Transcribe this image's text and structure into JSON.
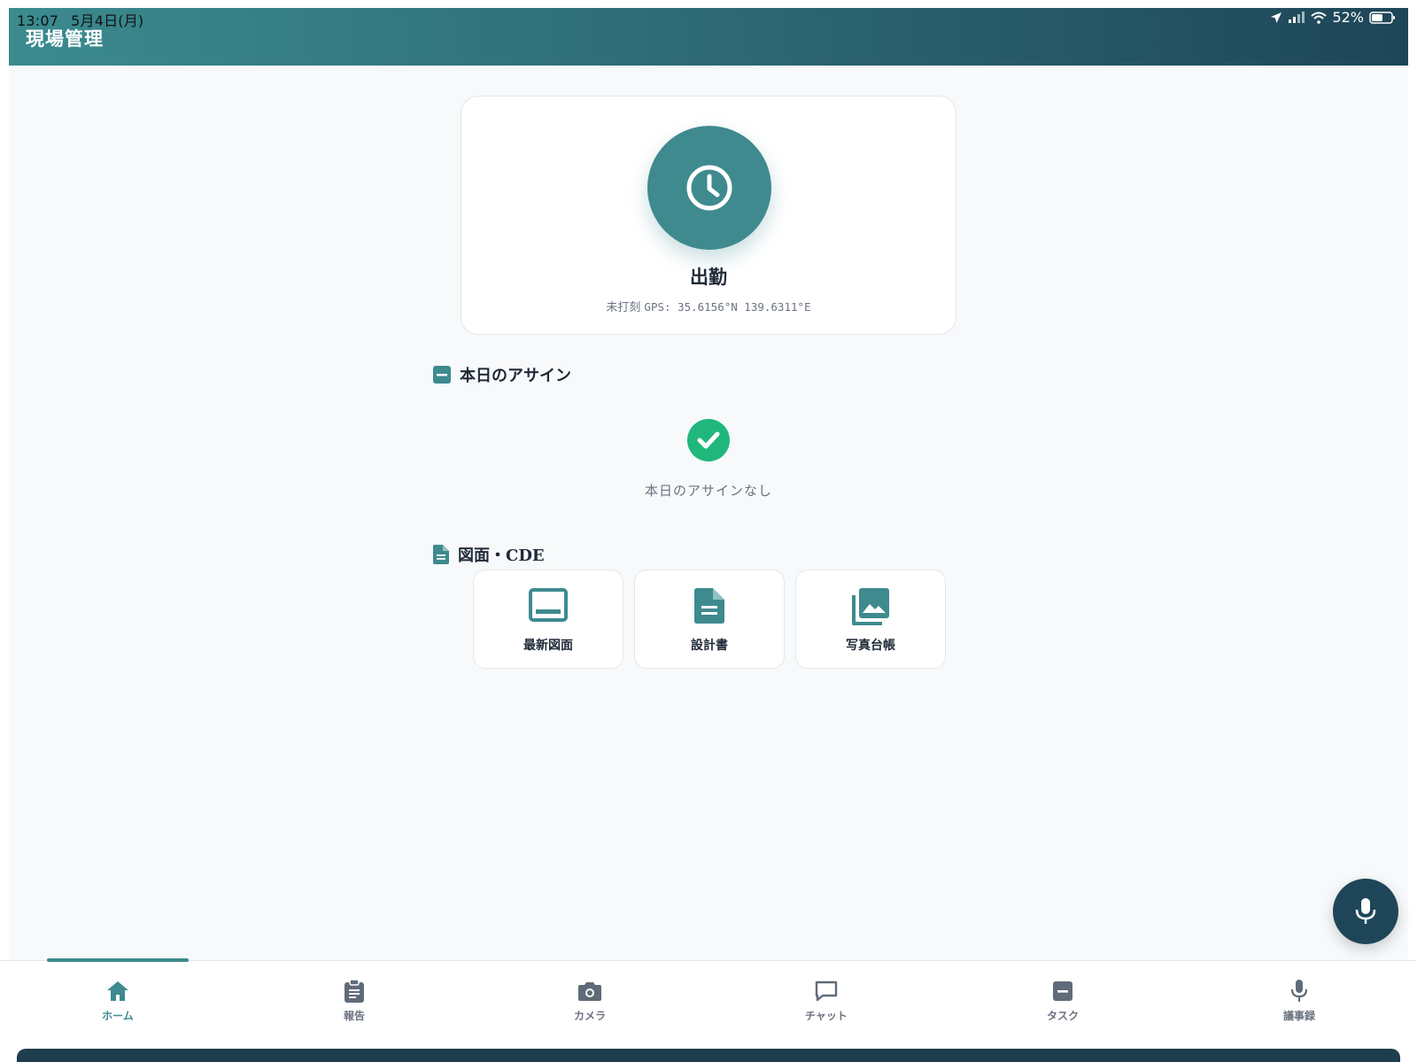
{
  "status_bar": {
    "time": "13:07",
    "date": "5月4日(月)",
    "battery": "52%"
  },
  "header": {
    "title": "現場管理"
  },
  "attendance": {
    "label": "出勤",
    "status": "未打刻",
    "gps": "GPS: 35.6156°N 139.6311°E"
  },
  "sections": {
    "assign": {
      "title": "本日のアサイン",
      "empty_text": "本日のアサインなし"
    },
    "cde": {
      "title": "図面・CDE",
      "tiles": [
        {
          "label": "最新図面",
          "icon": "drawing-icon"
        },
        {
          "label": "設計書",
          "icon": "document-icon"
        },
        {
          "label": "写真台帳",
          "icon": "photo-album-icon"
        }
      ]
    }
  },
  "tabs": [
    {
      "label": "ホーム",
      "icon": "home-icon",
      "active": true
    },
    {
      "label": "報告",
      "icon": "clipboard-icon"
    },
    {
      "label": "カメラ",
      "icon": "camera-icon"
    },
    {
      "label": "チャット",
      "icon": "chat-icon"
    },
    {
      "label": "タスク",
      "icon": "task-icon"
    },
    {
      "label": "議事録",
      "icon": "mic-icon"
    }
  ],
  "colors": {
    "accent": "#3e8a8f",
    "header_dark": "#1e4658",
    "success": "#1fb77c"
  }
}
